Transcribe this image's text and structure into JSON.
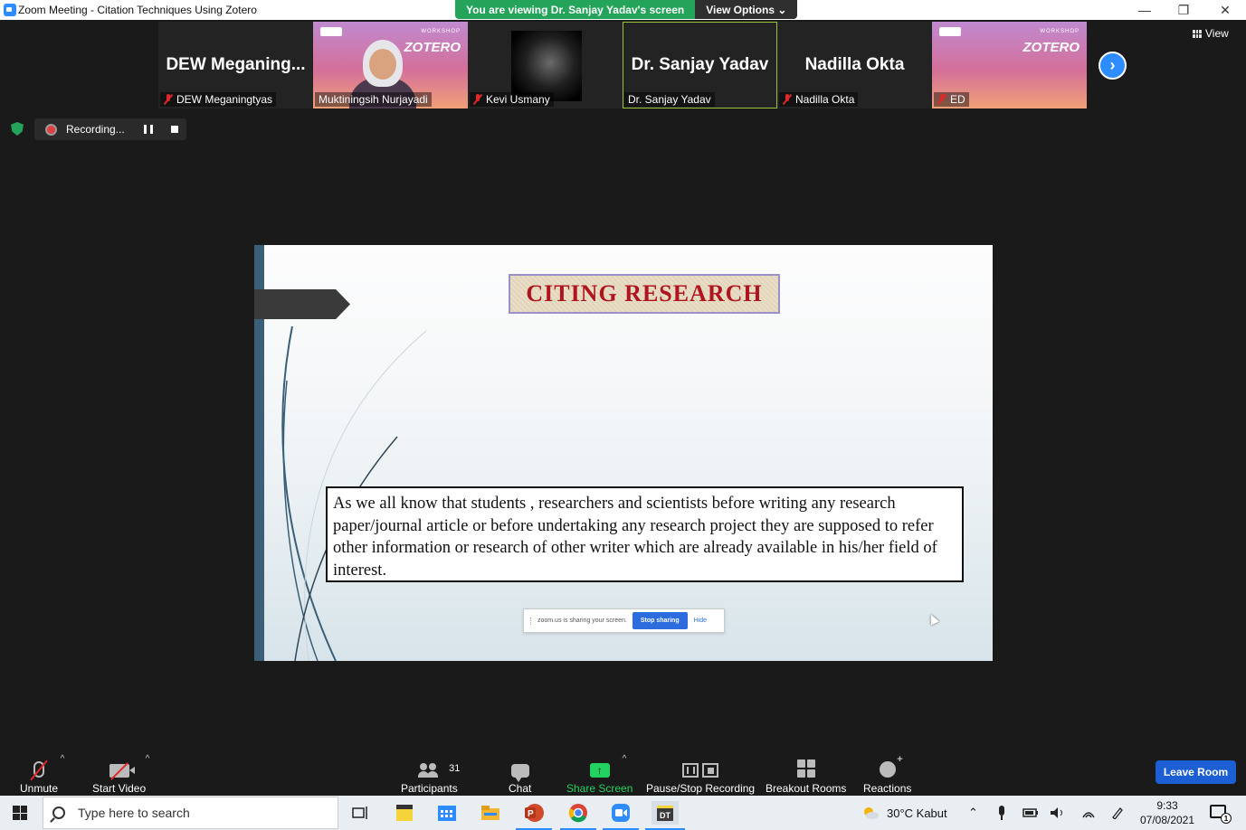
{
  "window": {
    "title": "Zoom Meeting - Citation Techniques Using Zotero",
    "controls": [
      "—",
      "❐",
      "✕"
    ]
  },
  "share_banner": {
    "viewing": "You are viewing Dr. Sanjay Yadav's screen",
    "view_options": "View Options ⌄"
  },
  "gallery": {
    "tiles": [
      {
        "big_name": "DEW  Meganing...",
        "tag": "DEW Meganingtyas",
        "muted": true,
        "kind": "name"
      },
      {
        "big_name": "",
        "tag": "Muktiningsih Nurjayadi",
        "muted": false,
        "kind": "video-woman"
      },
      {
        "big_name": "",
        "tag": "Kevi Usmany",
        "muted": true,
        "kind": "video-dark"
      },
      {
        "big_name": "Dr. Sanjay Yadav",
        "tag": "Dr. Sanjay Yadav",
        "muted": false,
        "kind": "name",
        "active": true
      },
      {
        "big_name": "Nadilla Okta",
        "tag": "Nadilla Okta",
        "muted": true,
        "kind": "name"
      },
      {
        "big_name": "",
        "tag": "ED",
        "muted": true,
        "kind": "poster"
      }
    ],
    "poster_workshop": "WORKSHOP",
    "poster_title": "ZOTERO",
    "view_label": "View"
  },
  "recording": {
    "label": "Recording..."
  },
  "slide": {
    "title": "CITING RESEARCH",
    "body": "As we all know that students , researchers and scientists  before writing any research paper/journal article or before undertaking any research project they are supposed to refer other information or research of other writer which are already available in his/her field of interest."
  },
  "share_toast": {
    "message": "zoom.us is sharing your screen.",
    "stop_label": "Stop sharing",
    "hide_label": "Hide"
  },
  "toolbar": {
    "unmute": "Unmute",
    "start_video": "Start Video",
    "participants": "Participants",
    "participants_count": "31",
    "chat": "Chat",
    "share_screen": "Share Screen",
    "pause_stop_recording": "Pause/Stop Recording",
    "breakout_rooms": "Breakout Rooms",
    "reactions": "Reactions",
    "leave_room": "Leave Room"
  },
  "taskbar": {
    "search_placeholder": "Type here to search",
    "weather": "30°C  Kabut",
    "time": "9:33",
    "date": "07/08/2021",
    "notification_count": "1"
  },
  "colors": {
    "zoom_blue": "#2d8cff",
    "share_green": "#23a45a",
    "slide_title_red": "#b0141e",
    "leave_blue": "#1c5fd4"
  }
}
